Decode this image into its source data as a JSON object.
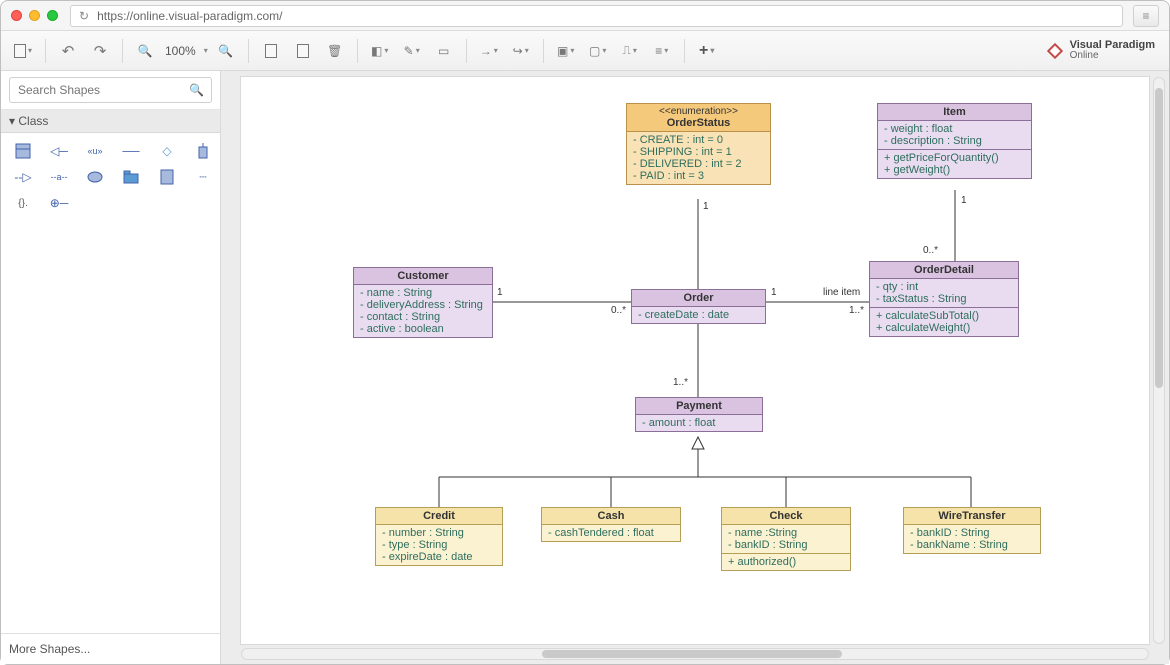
{
  "browser": {
    "url": "https://online.visual-paradigm.com/",
    "reload_icon": "↻",
    "menu_icon": "≡"
  },
  "brand": {
    "line1": "Visual Paradigm",
    "line2": "Online"
  },
  "toolbar": {
    "save": "Save",
    "undo": "Undo",
    "redo": "Redo",
    "zoom_out": "−",
    "zoom_label": "100%",
    "zoom_in": "+",
    "copy": "Copy",
    "paste": "Paste",
    "delete": "Delete",
    "fill": "Fill Color",
    "line": "Line Color",
    "shadow": "Shadow",
    "connector_end": "Line End",
    "connector_style": "Connector Style",
    "arrange_front": "To Front",
    "arrange_back": "To Back",
    "align": "Align",
    "distribute": "Distribute",
    "add": "+"
  },
  "sidebar": {
    "search_placeholder": "Search Shapes",
    "category": "Class",
    "shape_icons": [
      "class-icon",
      "generalization-icon",
      "usage-icon",
      "association-icon",
      "diamond-icon",
      "interface-icon",
      "dependency-icon",
      "label-icon",
      "note-icon",
      "package-icon",
      "document-icon",
      "constraint-icon",
      "anchor-icon"
    ],
    "more": "More Shapes..."
  },
  "diagram": {
    "classes": {
      "orderStatus": {
        "stereotype": "<<enumeration>>",
        "name": "OrderStatus",
        "literals": [
          "- CREATE : int  = 0",
          "- SHIPPING : int = 1",
          "- DELIVERED : int = 2",
          "- PAID : int = 3"
        ]
      },
      "item": {
        "name": "Item",
        "attrs": [
          "- weight : float",
          "- description : String"
        ],
        "ops": [
          "+ getPriceForQuantity()",
          "+ getWeight()"
        ]
      },
      "customer": {
        "name": "Customer",
        "attrs": [
          "- name : String",
          "- deliveryAddress : String",
          "- contact : String",
          "- active : boolean"
        ]
      },
      "order": {
        "name": "Order",
        "attrs": [
          "- createDate : date"
        ]
      },
      "orderDetail": {
        "name": "OrderDetail",
        "attrs": [
          "- qty : int",
          "- taxStatus : String"
        ],
        "ops": [
          "+ calculateSubTotal()",
          "+ calculateWeight()"
        ]
      },
      "payment": {
        "name": "Payment",
        "attrs": [
          "- amount : float"
        ]
      },
      "credit": {
        "name": "Credit",
        "attrs": [
          "- number : String",
          "- type : String",
          "- expireDate : date"
        ]
      },
      "cash": {
        "name": "Cash",
        "attrs": [
          "- cashTendered : float"
        ]
      },
      "check": {
        "name": "Check",
        "attrs": [
          "- name :String",
          "- bankID : String"
        ],
        "ops": [
          "+ authorized()"
        ]
      },
      "wireTransfer": {
        "name": "WireTransfer",
        "attrs": [
          "- bankID : String",
          "- bankName : String"
        ]
      }
    },
    "multiplicities": {
      "cust_order_left": "1",
      "cust_order_right": "0..*",
      "orderstatus_to_order": "1",
      "order_to_orderdetail_left": "1",
      "order_to_orderdetail_label": "line item",
      "order_to_orderdetail_right": "1..*",
      "item_to_orderdetail_top": "1",
      "item_to_orderdetail_bottom": "0..*",
      "order_to_payment": "1..*"
    }
  }
}
